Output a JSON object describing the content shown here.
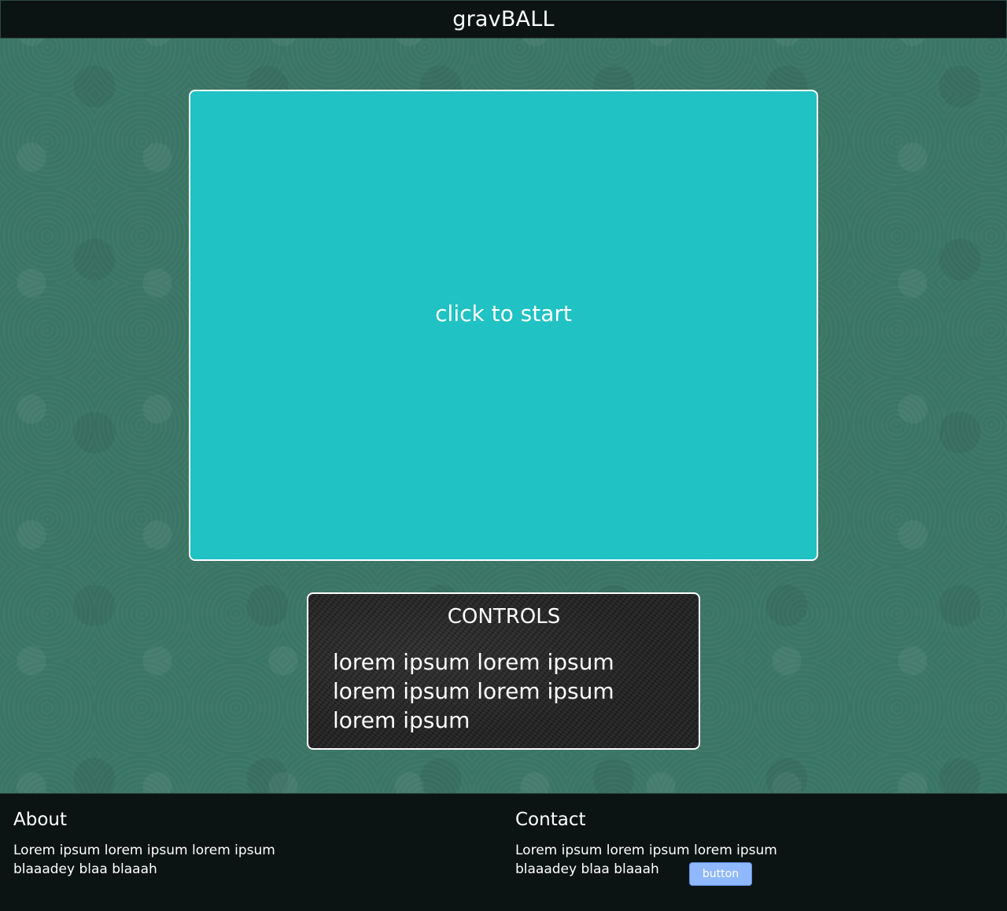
{
  "header": {
    "title": "gravBALL"
  },
  "game": {
    "start_prompt": "click to start",
    "bg_color": "#20c2c4"
  },
  "controls": {
    "heading": "CONTROLS",
    "body": "lorem ipsum lorem ipsum lorem ipsum lorem ipsum lorem ipsum"
  },
  "footer": {
    "about": {
      "heading": "About",
      "text": "Lorem ipsum lorem ipsum lorem ipsum blaaadey blaa blaaah"
    },
    "contact": {
      "heading": "Contact",
      "text": "Lorem ipsum lorem ipsum lorem ipsum blaaadey blaa blaaah"
    },
    "button_label": "button"
  },
  "colors": {
    "page_bg": "#3b7565",
    "bar_bg": "#0c1413",
    "button_bg": "#8fb8ff"
  }
}
